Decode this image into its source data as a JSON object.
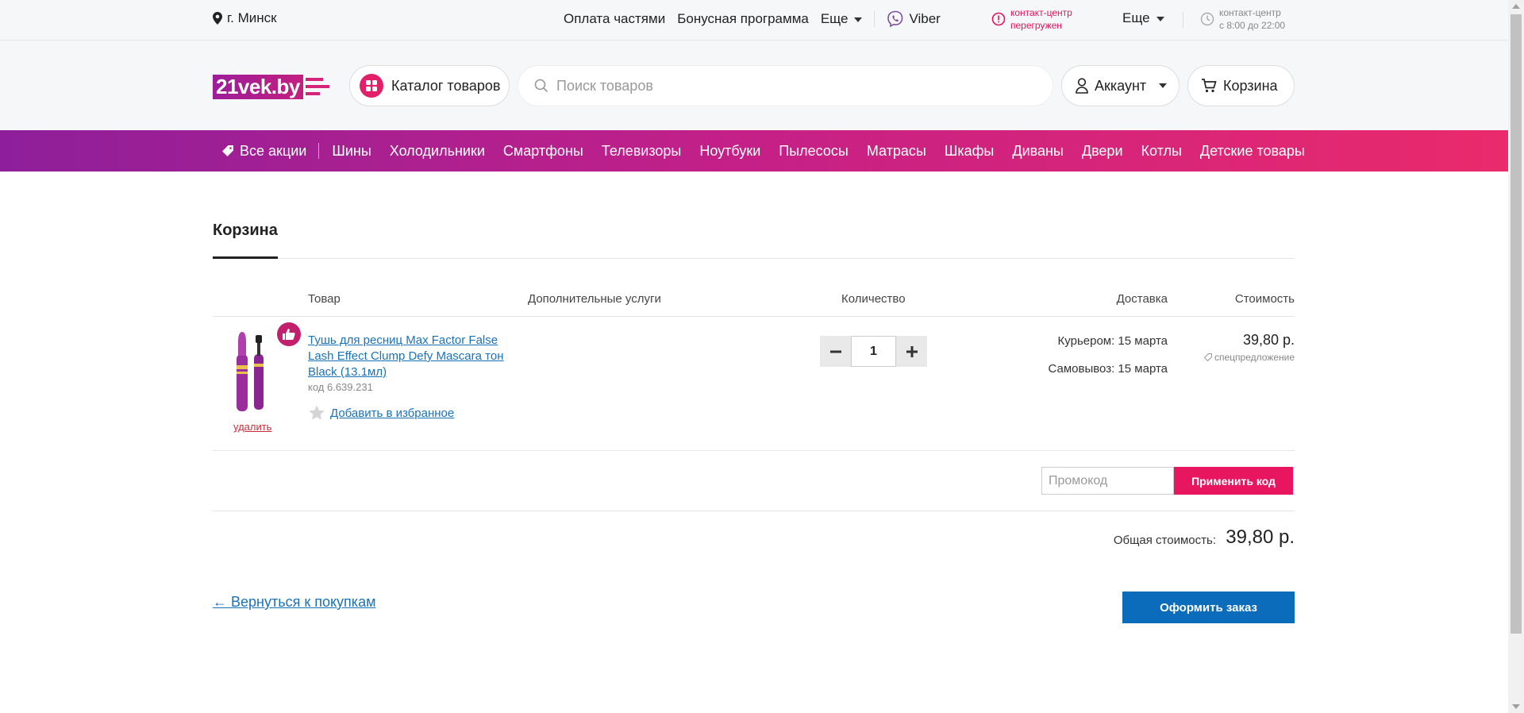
{
  "topbar": {
    "city": "г. Минск",
    "links": [
      "Оплата частями",
      "Бонусная программа"
    ],
    "more1": "Еще",
    "viber": "Viber",
    "contact_warning_line1": "контакт-центр",
    "contact_warning_line2": "перегружен",
    "more2": "Еще",
    "hours_line1": "контакт-центр",
    "hours_line2": "с 8:00 до 22:00"
  },
  "header": {
    "logo_text": "21vek.by",
    "catalog_label": "Каталог товаров",
    "search_placeholder": "Поиск товаров",
    "account_label": "Аккаунт",
    "cart_label": "Корзина"
  },
  "nav": {
    "all_promos": "Все акции",
    "items": [
      "Шины",
      "Холодильники",
      "Смартфоны",
      "Телевизоры",
      "Ноутбуки",
      "Пылесосы",
      "Матрасы",
      "Шкафы",
      "Диваны",
      "Двери",
      "Котлы",
      "Детские товары"
    ]
  },
  "cart": {
    "title": "Корзина",
    "columns": {
      "product": "Товар",
      "services": "Дополнительные услуги",
      "quantity": "Количество",
      "delivery": "Доставка",
      "cost": "Стоимость"
    },
    "item": {
      "name": "Тушь для ресниц Max Factor False Lash Effect Clump Defy Mascara тон Black (13.1мл)",
      "code": "код 6.639.231",
      "delete_label": "удалить",
      "favorite_label": "Добавить в избранное",
      "quantity": "1",
      "delivery_courier": "Курьером: 15 марта",
      "delivery_pickup": "Самовывоз: 15 марта",
      "price": "39,80 р.",
      "special_offer": "спецпредложение"
    },
    "promo": {
      "placeholder": "Промокод",
      "apply_label": "Применить код"
    },
    "total_label": "Общая стоимость:",
    "total_value": "39,80 р.",
    "back_link": "← Вернуться к покупкам",
    "checkout_label": "Оформить заказ"
  },
  "colors": {
    "accent_pink": "#e8165f",
    "link_blue": "#1a72b8",
    "checkout_blue": "#0a6cbb"
  }
}
